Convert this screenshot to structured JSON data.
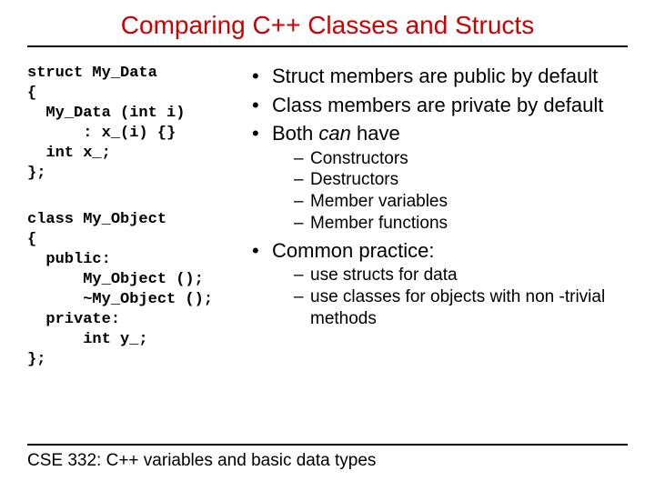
{
  "title": "Comparing C++ Classes and Structs",
  "code1": "struct My_Data\n{\n  My_Data (int i)\n      : x_(i) {}\n  int x_;\n};",
  "code2": "class My_Object\n{\n  public:\n      My_Object ();\n      ~My_Object ();\n  private:\n      int y_;\n};",
  "bullets": {
    "b1": "Struct members are public by default",
    "b2": "Class members are private by default",
    "b3a": "Both ",
    "b3b": "can",
    "b3c": " have",
    "sub1": [
      "Constructors",
      "Destructors",
      "Member variables",
      "Member functions"
    ],
    "b4": "Common practice:",
    "sub2": [
      "use structs for data",
      "use classes for objects with non -trivial methods"
    ]
  },
  "footer": "CSE 332: C++ variables and basic data types"
}
